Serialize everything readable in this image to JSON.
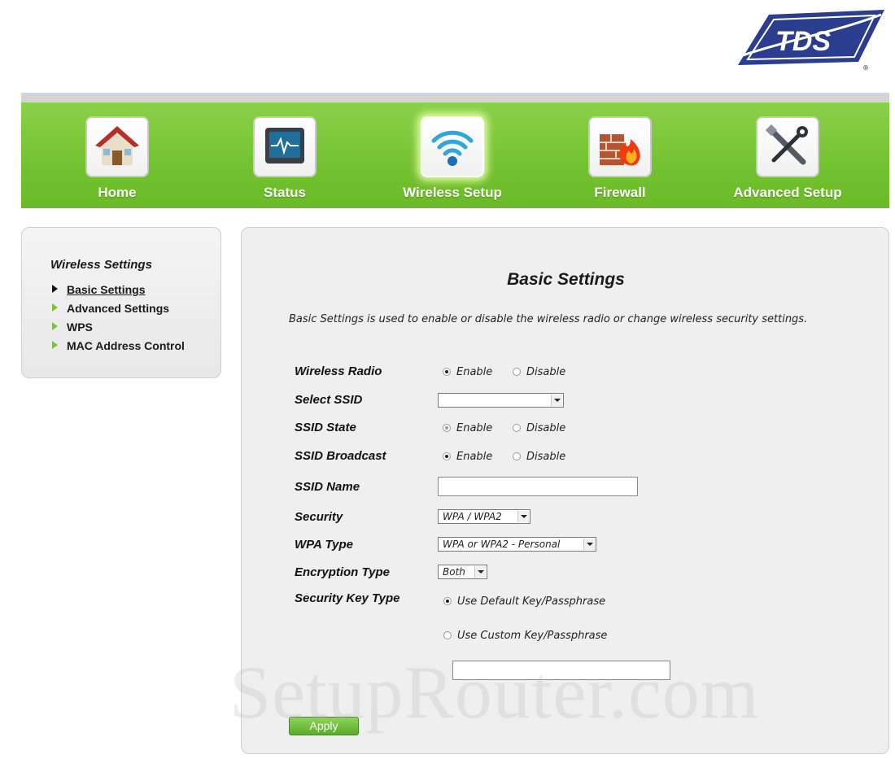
{
  "brand": {
    "logo_text": "TDS",
    "registered": "®",
    "nav_green": "#73c22f"
  },
  "nav": [
    {
      "label": "Home",
      "icon": "house-icon"
    },
    {
      "label": "Status",
      "icon": "monitor-icon"
    },
    {
      "label": "Wireless Setup",
      "icon": "wifi-icon",
      "active": true
    },
    {
      "label": "Firewall",
      "icon": "firewall-icon"
    },
    {
      "label": "Advanced Setup",
      "icon": "tools-icon"
    }
  ],
  "sidebar": {
    "title": "Wireless Settings",
    "items": [
      {
        "label": "Basic Settings",
        "active": true
      },
      {
        "label": "Advanced Settings"
      },
      {
        "label": "WPS"
      },
      {
        "label": "MAC Address Control"
      }
    ]
  },
  "main": {
    "title": "Basic Settings",
    "description": "Basic Settings is used to enable or disable the wireless radio or change wireless security settings.",
    "fields": {
      "wireless_radio": {
        "label": "Wireless Radio",
        "enable": "Enable",
        "disable": "Disable",
        "value": "Enable"
      },
      "select_ssid": {
        "label": "Select SSID",
        "value": ""
      },
      "ssid_state": {
        "label": "SSID State",
        "enable": "Enable",
        "disable": "Disable",
        "value": "Enable"
      },
      "ssid_broadcast": {
        "label": "SSID Broadcast",
        "enable": "Enable",
        "disable": "Disable",
        "value": "Enable"
      },
      "ssid_name": {
        "label": "SSID Name",
        "value": ""
      },
      "security": {
        "label": "Security",
        "value": "WPA / WPA2"
      },
      "wpa_type": {
        "label": "WPA Type",
        "value": "WPA or WPA2 - Personal"
      },
      "encryption_type": {
        "label": "Encryption Type",
        "value": "Both"
      },
      "security_key_type": {
        "label": "Security Key Type",
        "default_option": "Use Default Key/Passphrase",
        "custom_option": "Use Custom Key/Passphrase",
        "value": "default",
        "custom_key": ""
      }
    },
    "apply_label": "Apply"
  },
  "watermark": "SetupRouter.com"
}
